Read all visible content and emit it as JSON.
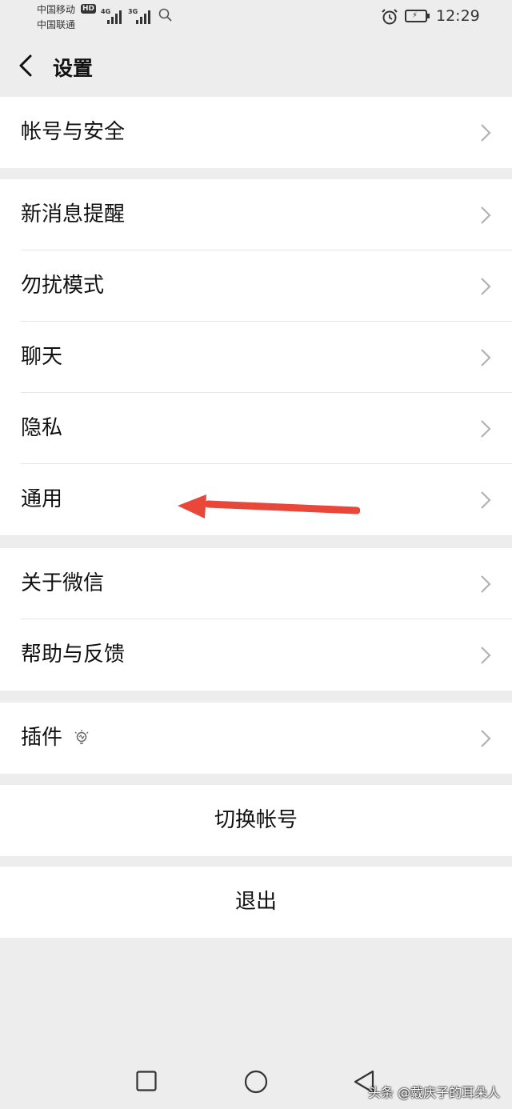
{
  "status_bar": {
    "carrier_1": "中国移动",
    "carrier_1_badge": "HD",
    "network_1": "4G",
    "carrier_2": "中国联通",
    "network_2": "3G",
    "time": "12:29"
  },
  "nav": {
    "title": "设置"
  },
  "groups": {
    "account": {
      "items": [
        {
          "label": "帐号与安全"
        }
      ]
    },
    "main": {
      "items": [
        {
          "label": "新消息提醒"
        },
        {
          "label": "勿扰模式"
        },
        {
          "label": "聊天"
        },
        {
          "label": "隐私"
        },
        {
          "label": "通用"
        }
      ]
    },
    "info": {
      "items": [
        {
          "label": "关于微信"
        },
        {
          "label": "帮助与反馈"
        }
      ]
    },
    "plugins": {
      "items": [
        {
          "label": "插件"
        }
      ]
    }
  },
  "actions": {
    "switch_account": "切换帐号",
    "logout": "退出"
  },
  "annotation_color": "#e8473a",
  "watermark": "头条 @戴庆子的耳朵人"
}
